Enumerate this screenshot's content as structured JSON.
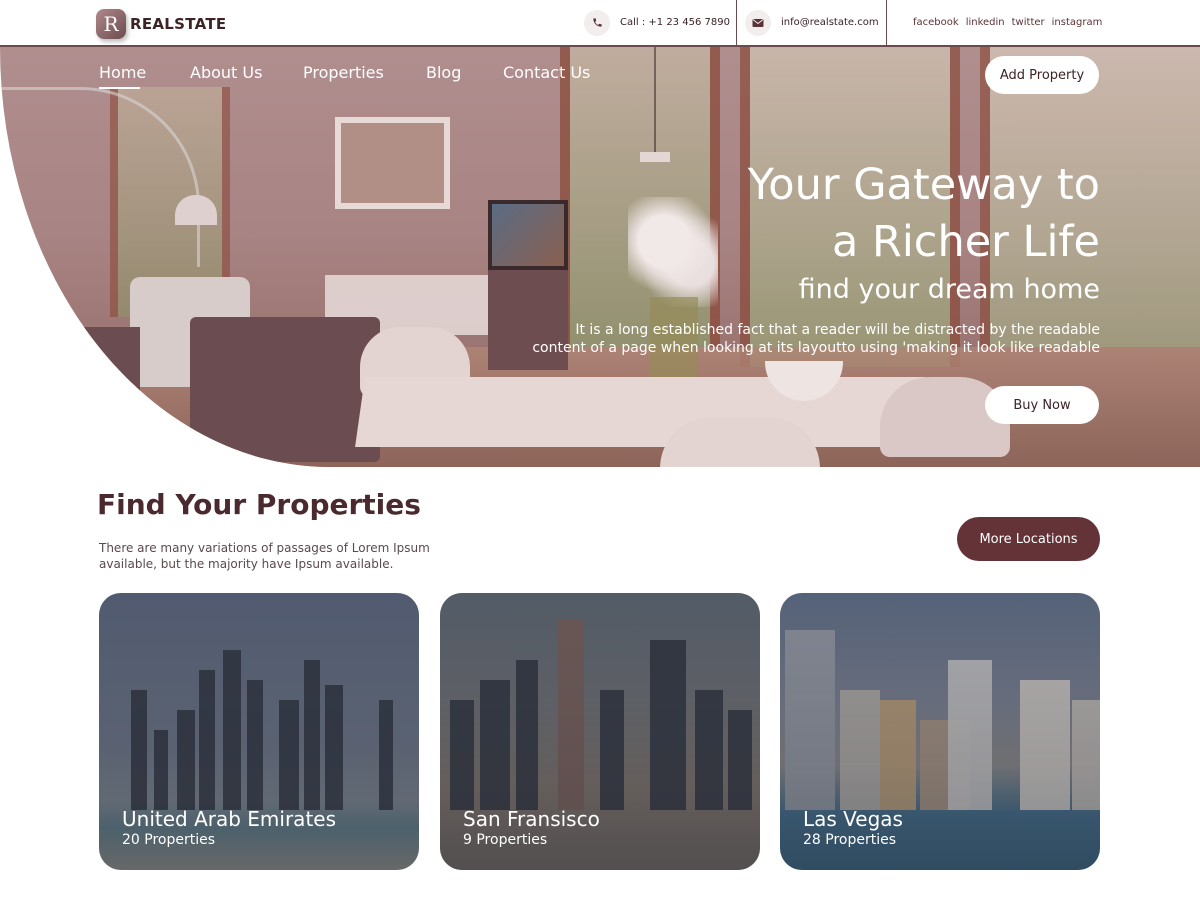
{
  "brand": {
    "logo_letter": "R",
    "name": "REALSTATE"
  },
  "topbar": {
    "call": {
      "icon": "phone-icon",
      "text": "Call : +1 23 456 7890"
    },
    "email": {
      "icon": "mail-icon",
      "text": "info@realstate.com"
    },
    "socials": [
      "facebook",
      "linkedin",
      "twitter",
      "instagram"
    ]
  },
  "nav": {
    "items": [
      "Home",
      "About Us",
      "Properties",
      "Blog",
      "Contact Us"
    ],
    "active": "Home",
    "add_property": "Add Property"
  },
  "hero": {
    "title_line1": "Your Gateway to",
    "title_line2": "a Richer Life",
    "subtitle": "find your dream home",
    "description_line1": "It is a long established fact that a reader will be distracted by the readable",
    "description_line2": "content of a page when looking at its layoutto using 'making it look like readable",
    "cta": "Buy Now"
  },
  "properties": {
    "title": "Find Your Properties",
    "description_line1": "There are many variations of passages of Lorem Ipsum",
    "description_line2": "available, but the majority have Ipsum available.",
    "more_button": "More Locations",
    "cards": [
      {
        "name": "United Arab Emirates",
        "count": "20 Properties"
      },
      {
        "name": "San Fransisco",
        "count": "9 Properties"
      },
      {
        "name": "Las Vegas",
        "count": "28 Properties"
      }
    ]
  },
  "colors": {
    "primary": "#643338",
    "accent_overlay": "#784650",
    "text_dark": "#4a2a2e",
    "white": "#ffffff"
  }
}
